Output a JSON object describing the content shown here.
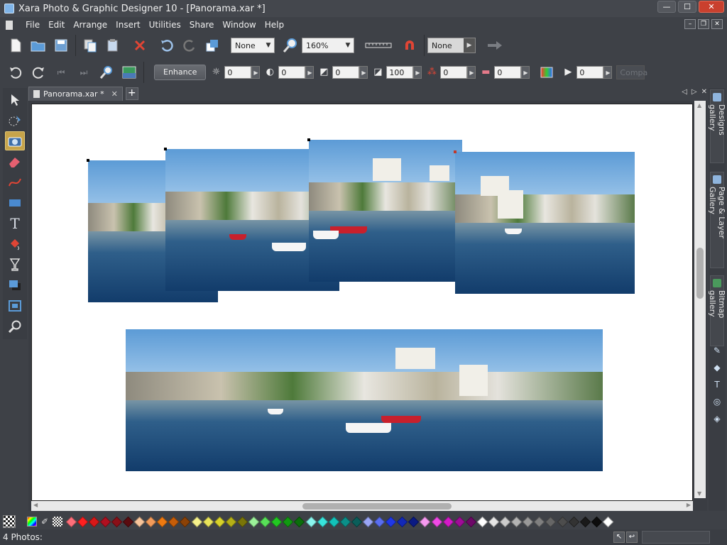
{
  "window": {
    "title": "Xara Photo & Graphic Designer 10 - [Panorama.xar *]",
    "min_label": "—",
    "max_label": "☐",
    "close_label": "✕"
  },
  "menu": {
    "items": [
      "File",
      "Edit",
      "Arrange",
      "Insert",
      "Utilities",
      "Share",
      "Window",
      "Help"
    ],
    "mdi_min": "–",
    "mdi_restore": "❐",
    "mdi_close": "✕"
  },
  "toolbar1": {
    "icons": [
      "new-document",
      "open",
      "save",
      "copy-pages",
      "paste",
      "delete",
      "undo",
      "redo",
      "bring-to-front"
    ],
    "quality_value": "None",
    "zoom_value": "160%",
    "snap_value": "None"
  },
  "toolbar2": {
    "enhance_label": "Enhance",
    "brightness": "0",
    "contrast": "0",
    "saturation": "0",
    "sharpness": "100",
    "color_balance": "0",
    "temperature": "0",
    "play_value": "0",
    "compare_label": "Compa"
  },
  "tabs": {
    "document_tab": "Panorama.xar *",
    "close_label": "✕",
    "new_tab_label": "+",
    "nav_prev": "◁",
    "nav_next": "▷",
    "nav_close": "✕"
  },
  "right_panel": {
    "designs_gallery": "Designs gallery",
    "page_layer_gallery": "Page & Layer Gallery",
    "bitmap_gallery": "Bitmap gallery"
  },
  "colorline": {
    "swatches": [
      "#ff6f7a",
      "#ff2020",
      "#d81818",
      "#b01020",
      "#8a1018",
      "#5a0c10",
      "#f7c49a",
      "#f39b5a",
      "#f07a10",
      "#c65d08",
      "#8c4206",
      "#f6f28c",
      "#e9e45a",
      "#d8d22a",
      "#b6b016",
      "#7a7608",
      "#9cf29a",
      "#58e058",
      "#22c822",
      "#119a11",
      "#0b6e0b",
      "#8af6ee",
      "#38e4dc",
      "#12c2ba",
      "#0b8f89",
      "#0a5e5a",
      "#9aa6f6",
      "#5a6ef0",
      "#2038e8",
      "#1228b8",
      "#0a1a84",
      "#f69af0",
      "#f04ae6",
      "#d41ac8",
      "#a00c98",
      "#6e0868",
      "#ffffff",
      "#e6e6e6",
      "#cccccc",
      "#b3b3b3",
      "#999999",
      "#808080",
      "#666666",
      "#4d4d4d",
      "#333333",
      "#1a1a1a",
      "#0d0d0d",
      "#ffffff"
    ]
  },
  "status": {
    "text": "4 Photos:"
  },
  "colors": {
    "accent": "#c7a44a",
    "chrome": "#3e4147",
    "close_red": "#c9402e"
  }
}
